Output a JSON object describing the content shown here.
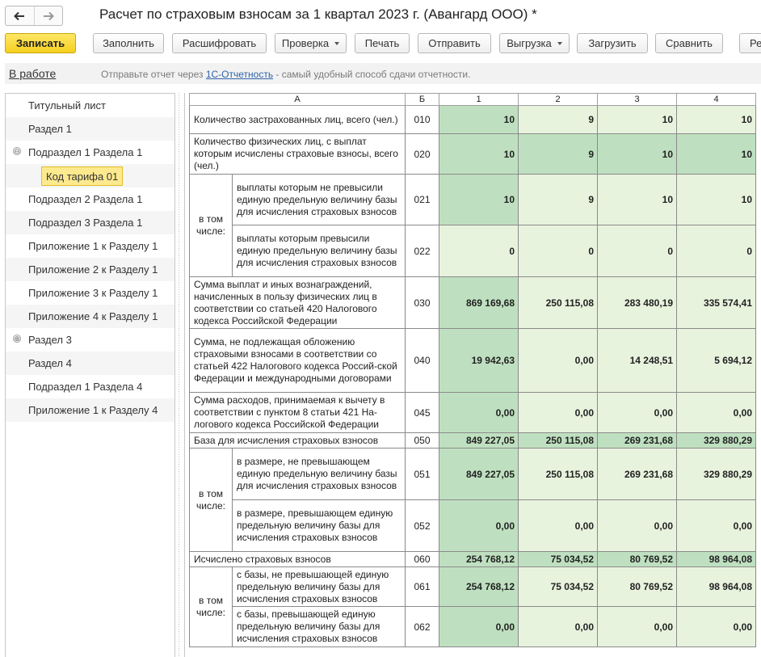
{
  "window": {
    "title": "Расчет по страховым взносам за 1 квартал 2023 г. (Авангард ООО) *"
  },
  "toolbar": {
    "save": "Записать",
    "fill": "Заполнить",
    "decode": "Расшифровать",
    "check": "Проверка",
    "print": "Печать",
    "send": "Отправить",
    "export": "Выгрузка",
    "load": "Загрузить",
    "compare": "Сравнить",
    "more": "Ре"
  },
  "infobar": {
    "status": "В работе",
    "text_before": "Отправьте отчет через ",
    "link": "1С-Отчетность",
    "text_after": " - самый удобный способ сдачи отчетности."
  },
  "sidebar": {
    "items": [
      {
        "label": "Титульный лист"
      },
      {
        "label": "Раздел 1"
      },
      {
        "label": "Подраздел 1 Раздела 1",
        "toggle": "⊖"
      },
      {
        "label": "Код тарифа 01"
      },
      {
        "label": "Подраздел 2 Раздела 1"
      },
      {
        "label": "Подраздел 3 Раздела 1"
      },
      {
        "label": "Приложение 1 к Разделу 1"
      },
      {
        "label": "Приложение 2 к Разделу 1"
      },
      {
        "label": "Приложение 3 к Разделу 1"
      },
      {
        "label": "Приложение 4 к Разделу 1"
      },
      {
        "label": "Раздел 3",
        "toggle": "⊕"
      },
      {
        "label": "Раздел 4"
      },
      {
        "label": "Подраздел 1 Раздела 4"
      },
      {
        "label": "Приложение 1 к Разделу 4"
      }
    ]
  },
  "report": {
    "headers": {
      "a": "А",
      "b": "Б",
      "c1": "1",
      "c2": "2",
      "c3": "3",
      "c4": "4"
    },
    "subgroup_label": "в том числе:",
    "rows": [
      {
        "label": "Количество застрахованных лиц, всего (чел.)",
        "code": "010",
        "values": [
          "10",
          "9",
          "10",
          "10"
        ]
      },
      {
        "label": "Количество физических лиц, с выплат которым исчислены страховые взносы, всего (чел.)",
        "code": "020",
        "values": [
          "10",
          "9",
          "10",
          "10"
        ]
      },
      {
        "label": "выплаты которым не превысили единую предельную величину базы для исчисления страховых взносов",
        "code": "021",
        "values": [
          "10",
          "9",
          "10",
          "10"
        ]
      },
      {
        "label": "выплаты которым превысили единую предельную величину базы для исчисления страховых взносов",
        "code": "022",
        "values": [
          "0",
          "0",
          "0",
          "0"
        ]
      },
      {
        "label": "Сумма выплат и иных вознаграждений, начисленных в пользу физических лиц в соответствии со статьей 420 Налогового кодекса Российской Федерации",
        "code": "030",
        "values": [
          "869 169,68",
          "250 115,08",
          "283 480,19",
          "335 574,41"
        ]
      },
      {
        "label": "Сумма, не подлежащая обложению страховыми взносами в соответствии со статьей 422 Налогового кодекса Россий-ской Федерации и международными договорами",
        "code": "040",
        "values": [
          "19 942,63",
          "0,00",
          "14 248,51",
          "5 694,12"
        ]
      },
      {
        "label": "Сумма расходов, принимаемая к вычету в соответствии с пунктом 8 статьи 421 На-логового кодекса Российской Федерации",
        "code": "045",
        "values": [
          "0,00",
          "0,00",
          "0,00",
          "0,00"
        ]
      },
      {
        "label": "База для исчисления страховых взносов",
        "code": "050",
        "values": [
          "849 227,05",
          "250 115,08",
          "269 231,68",
          "329 880,29"
        ]
      },
      {
        "label": "в размере, не превышающем единую предельную величину базы для исчисления страховых взносов",
        "code": "051",
        "values": [
          "849 227,05",
          "250 115,08",
          "269 231,68",
          "329 880,29"
        ]
      },
      {
        "label": "в размере, превышающем единую предельную величину базы для исчисления страховых взносов",
        "code": "052",
        "values": [
          "0,00",
          "0,00",
          "0,00",
          "0,00"
        ]
      },
      {
        "label": "Исчислено страховых взносов",
        "code": "060",
        "values": [
          "254 768,12",
          "75 034,52",
          "80 769,52",
          "98 964,08"
        ]
      },
      {
        "label": "с базы, не превышающей единую предельную величину базы для исчисления страховых взносов",
        "code": "061",
        "values": [
          "254 768,12",
          "75 034,52",
          "80 769,52",
          "98 964,08"
        ]
      },
      {
        "label": "с базы, превышающей единую предельную величину базы для исчисления страховых взносов",
        "code": "062",
        "values": [
          "0,00",
          "0,00",
          "0,00",
          "0,00"
        ]
      }
    ]
  },
  "colors": {
    "primary_button": "#f5cf1f",
    "selected_item": "#fde98e",
    "cell_column1": "#bfe0c0",
    "cell_other": "#e8f3de",
    "link": "#2f63a8"
  }
}
